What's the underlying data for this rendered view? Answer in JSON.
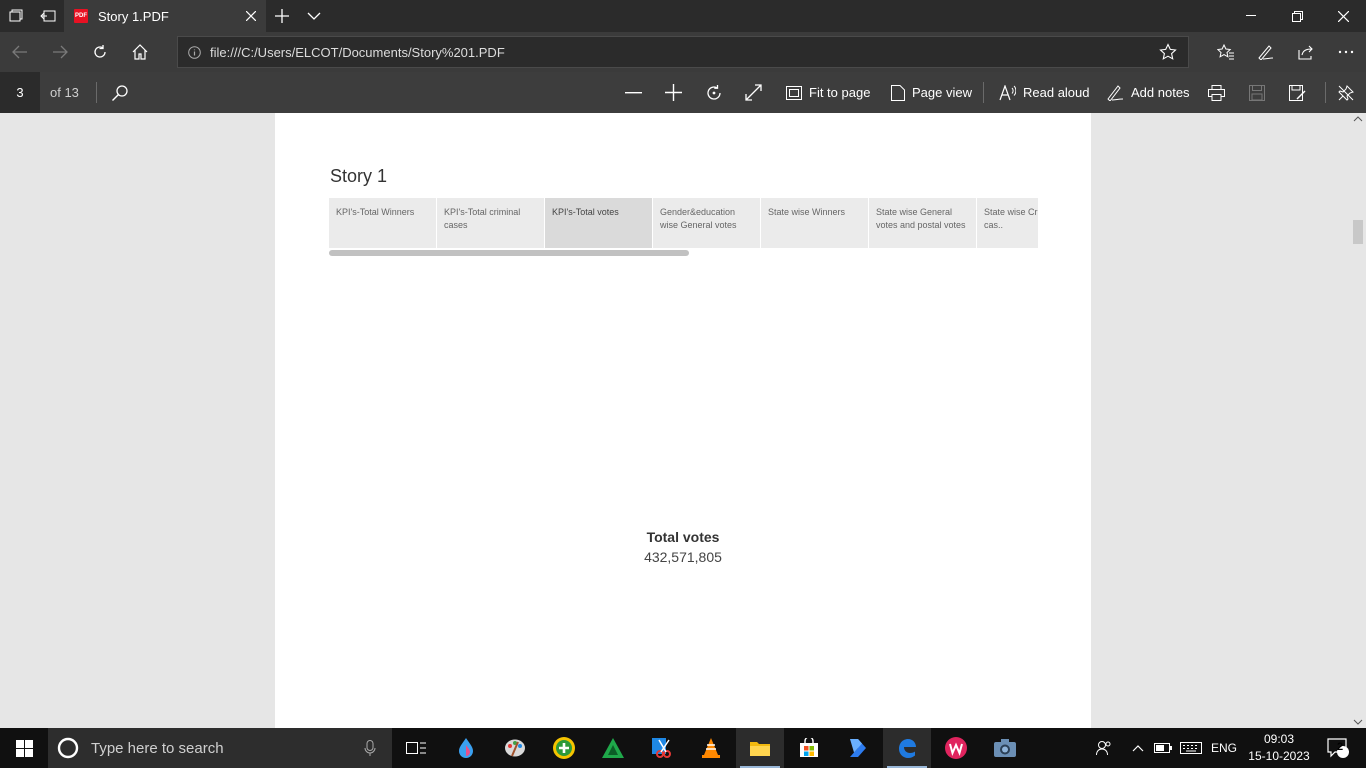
{
  "browser": {
    "tab_title": "Story 1.PDF",
    "favicon_text": "PDF",
    "url": "file:///C:/Users/ELCOT/Documents/Story%201.PDF"
  },
  "pdf_toolbar": {
    "current_page": "3",
    "page_count": "of 13",
    "fit_to_page": "Fit to page",
    "page_view": "Page view",
    "read_aloud": "Read aloud",
    "add_notes": "Add notes"
  },
  "story": {
    "title": "Story 1",
    "tabs": [
      {
        "label": "KPI's-Total Winners"
      },
      {
        "label": "KPI's-Total criminal cases"
      },
      {
        "label": "KPI's-Total votes"
      },
      {
        "label": "Gender&education wise General votes"
      },
      {
        "label": "State wise Winners"
      },
      {
        "label": "State wise General votes and postal votes"
      },
      {
        "label": "State wise Criminal cas.."
      }
    ],
    "active_tab_index": 2,
    "kpi_label": "Total votes",
    "kpi_value": "432,571,805"
  },
  "taskbar": {
    "search_placeholder": "Type here to search",
    "language": "ENG",
    "time": "09:03",
    "date": "15-10-2023",
    "notification_count": "2"
  },
  "colors": {
    "accent": "#0078d7",
    "edge_blue": "#1f7ae0",
    "pdf_red": "#e81123"
  }
}
